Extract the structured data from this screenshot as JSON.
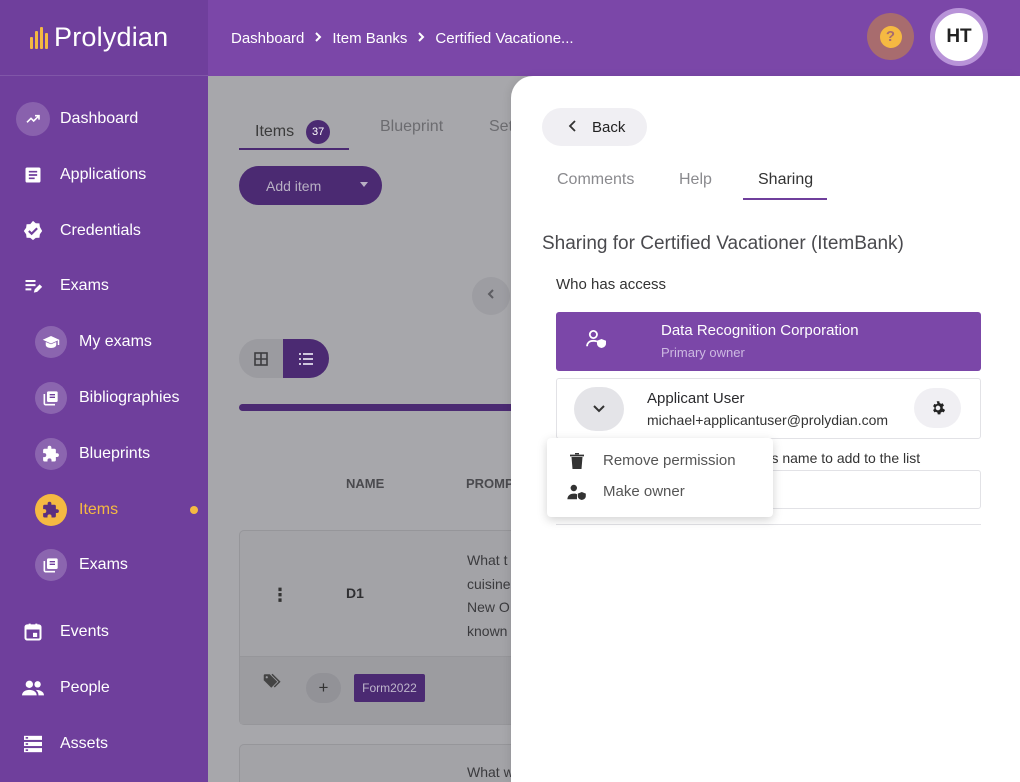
{
  "app": {
    "logo_text": "Prolydian",
    "brand_color": "#6f3f9c",
    "accent_color": "#f5b942"
  },
  "header": {
    "breadcrumbs": [
      "Dashboard",
      "Item Banks",
      "Certified Vacatione..."
    ],
    "help_icon": "help-circle-icon",
    "avatar_initials": "HT"
  },
  "sidebar": {
    "items": [
      {
        "label": "Dashboard",
        "icon": "trend-up-icon"
      },
      {
        "label": "Applications",
        "icon": "document-icon"
      },
      {
        "label": "Credentials",
        "icon": "verified-badge-icon"
      },
      {
        "label": "Exams",
        "icon": "edit-list-icon"
      },
      {
        "label": "My exams",
        "icon": "graduation-cap-icon"
      },
      {
        "label": "Bibliographies",
        "icon": "library-books-icon"
      },
      {
        "label": "Blueprints",
        "icon": "puzzle-icon"
      },
      {
        "label": "Items",
        "icon": "puzzle-icon",
        "active": true
      },
      {
        "label": "Exams",
        "icon": "library-books-icon"
      },
      {
        "label": "Events",
        "icon": "calendar-icon"
      },
      {
        "label": "People",
        "icon": "people-icon"
      },
      {
        "label": "Assets",
        "icon": "storage-icon"
      }
    ]
  },
  "content": {
    "tabs": [
      {
        "label": "Items",
        "count": "37"
      },
      {
        "label": "Blueprint"
      },
      {
        "label": "Set"
      }
    ],
    "add_item_label": "Add item",
    "columns": {
      "name": "NAME",
      "prompt": "PROMP"
    },
    "rows": [
      {
        "id": "D1",
        "prompt": "What t\ncuisine\nNew O\nknown",
        "tag": "Form2022"
      },
      {
        "prompt": "What w"
      }
    ]
  },
  "panel": {
    "back_label": "Back",
    "tabs": [
      "Comments",
      "Help",
      "Sharing"
    ],
    "active_tab": "Sharing",
    "title": "Sharing for Certified Vacationer (ItemBank)",
    "who_has_access": "Who has access",
    "owner": {
      "name": "Data Recognition Corporation",
      "role": "Primary owner"
    },
    "user": {
      "name": "Applicant User",
      "email": "michael+applicantuser@prolydian.com"
    },
    "add_hint": "n's name to add to the list"
  },
  "menu": {
    "items": [
      {
        "label": "Remove permission",
        "icon": "trash-icon"
      },
      {
        "label": "Make owner",
        "icon": "person-shield-icon"
      }
    ]
  }
}
